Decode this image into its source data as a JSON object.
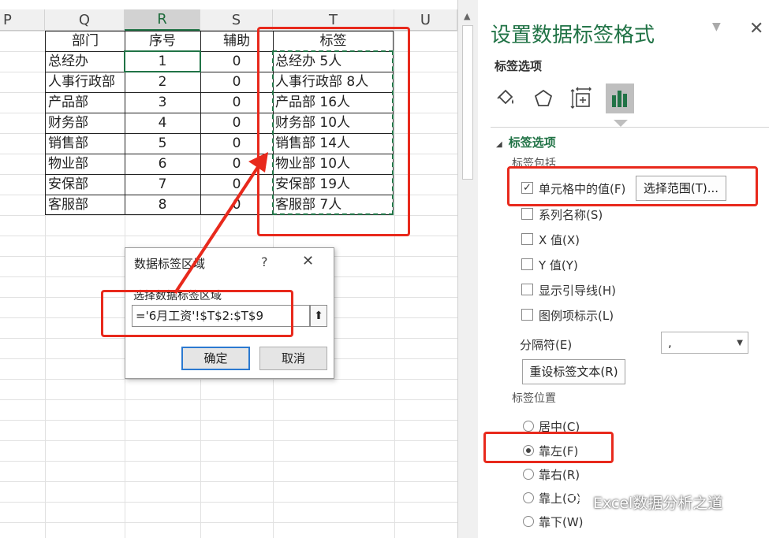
{
  "columns": [
    {
      "id": "P",
      "label": "P"
    },
    {
      "id": "Q",
      "label": "Q"
    },
    {
      "id": "R",
      "label": "R"
    },
    {
      "id": "S",
      "label": "S"
    },
    {
      "id": "T",
      "label": "T"
    },
    {
      "id": "U",
      "label": "U"
    }
  ],
  "table": {
    "headers": [
      "部门",
      "序号",
      "辅助",
      "标签"
    ],
    "rows": [
      [
        "总经办",
        "1",
        "0",
        "总经办  5人"
      ],
      [
        "人事行政部",
        "2",
        "0",
        "人事行政部  8人"
      ],
      [
        "产品部",
        "3",
        "0",
        "产品部  16人"
      ],
      [
        "财务部",
        "4",
        "0",
        "财务部  10人"
      ],
      [
        "销售部",
        "5",
        "0",
        "销售部  14人"
      ],
      [
        "物业部",
        "6",
        "0",
        "物业部  10人"
      ],
      [
        "安保部",
        "7",
        "0",
        "安保部  19人"
      ],
      [
        "客服部",
        "8",
        "0",
        "客服部  7人"
      ]
    ]
  },
  "pane": {
    "title": "设置数据标签格式",
    "close_glyph": "✕",
    "dropdown_glyph": "▼",
    "subtitle": "标签选项",
    "tabs": [
      {
        "name": "fill-line",
        "icon": "paint-bucket-icon"
      },
      {
        "name": "effects",
        "icon": "pentagon-icon"
      },
      {
        "name": "size-properties",
        "icon": "size-properties-icon"
      },
      {
        "name": "label-options",
        "icon": "bar-chart-icon"
      }
    ],
    "section_title": "标签选项",
    "contains_label": "标签包括",
    "checkboxes": [
      {
        "label": "单元格中的值(F)",
        "checked": true
      },
      {
        "label": "系列名称(S)",
        "checked": false
      },
      {
        "label": "X 值(X)",
        "checked": false
      },
      {
        "label": "Y 值(Y)",
        "checked": false
      },
      {
        "label": "显示引导线(H)",
        "checked": false
      },
      {
        "label": "图例项标示(L)",
        "checked": false
      }
    ],
    "select_range_button": "选择范围(T)...",
    "separator_label": "分隔符(E)",
    "separator_value": ",",
    "reset_button": "重设标签文本(R)",
    "position_label": "标签位置",
    "positions": [
      {
        "label": "居中(C)",
        "selected": false
      },
      {
        "label": "靠左(F)",
        "selected": true
      },
      {
        "label": "靠右(R)",
        "selected": false
      },
      {
        "label": "靠上(O)",
        "selected": false
      },
      {
        "label": "靠下(W)",
        "selected": false
      }
    ]
  },
  "dialog": {
    "title": "数据标签区域",
    "help": "?",
    "close": "✕",
    "label": "选择数据标签区域",
    "input_value": "='6月工资'!$T$2:$T$9",
    "collapse_glyph": "⬆",
    "ok": "确定",
    "cancel": "取消"
  },
  "watermark": "Excel数据分析之道",
  "colors": {
    "excel_green": "#217346",
    "annotation_red": "#e8291c"
  }
}
